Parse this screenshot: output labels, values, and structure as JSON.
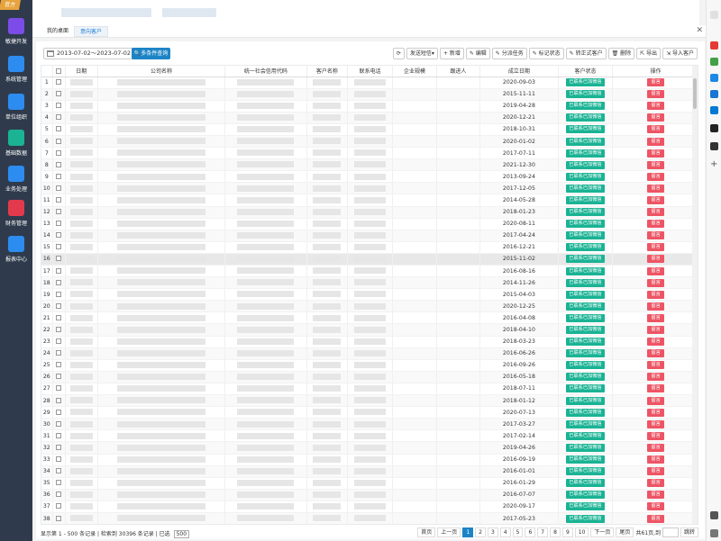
{
  "sidebar": {
    "badge": "官方",
    "items": [
      {
        "label": "敏捷开发",
        "icon": "paper-plane-icon",
        "color": "#7c4ce8"
      },
      {
        "label": "系统管理",
        "icon": "monitor-icon",
        "color": "#2d8cf0"
      },
      {
        "label": "单位组织",
        "icon": "coffee-cup-icon",
        "color": "#2d8cf0"
      },
      {
        "label": "基础数据",
        "icon": "database-icon",
        "color": "#1ab394"
      },
      {
        "label": "业务处理",
        "icon": "snowflake-icon",
        "color": "#2d8cf0"
      },
      {
        "label": "财务管理",
        "icon": "finance-icon",
        "color": "#e23a4c"
      },
      {
        "label": "报表中心",
        "icon": "chart-icon",
        "color": "#2d8cf0"
      }
    ]
  },
  "tabs": [
    {
      "label": "我的桌面"
    },
    {
      "label": "意向客户"
    }
  ],
  "search": {
    "date_range": "2013-07-02～2023-07-02",
    "button": "多条件查询"
  },
  "toolbar": [
    {
      "label": "⟳",
      "name": "refresh-button"
    },
    {
      "label": "发送短信▾",
      "name": "send-sms-button"
    },
    {
      "label": "+ 新增",
      "name": "add-button"
    },
    {
      "label": "✎ 编辑",
      "name": "edit-button"
    },
    {
      "label": "✎ 分派任务",
      "name": "assign-task-button"
    },
    {
      "label": "✎ 标记状态",
      "name": "mark-status-button"
    },
    {
      "label": "✎ 转正式客户",
      "name": "convert-customer-button"
    },
    {
      "label": "🗑 删除",
      "name": "delete-button"
    },
    {
      "label": "⇱ 导出",
      "name": "export-button"
    },
    {
      "label": "⇲ 导入客户",
      "name": "import-customer-button"
    }
  ],
  "table": {
    "headers": [
      "",
      "",
      "日期",
      "公司名称",
      "统一社会信用代码",
      "客户名称",
      "联系电话",
      "企业规模",
      "跟进人",
      "成立日期",
      "客户状态",
      "操作"
    ],
    "status_label": "已联系已加微信",
    "action_label": "留言",
    "rows": [
      {
        "n": "1",
        "d": "2020-09-03"
      },
      {
        "n": "2",
        "d": "2015-11-11"
      },
      {
        "n": "3",
        "d": "2019-04-28"
      },
      {
        "n": "4",
        "d": "2020-12-21"
      },
      {
        "n": "5",
        "d": "2018-10-31"
      },
      {
        "n": "6",
        "d": "2020-01-02"
      },
      {
        "n": "7",
        "d": "2017-07-11"
      },
      {
        "n": "8",
        "d": "2021-12-30"
      },
      {
        "n": "9",
        "d": "2013-09-24"
      },
      {
        "n": "10",
        "d": "2017-12-05"
      },
      {
        "n": "11",
        "d": "2014-05-28"
      },
      {
        "n": "12",
        "d": "2018-01-23"
      },
      {
        "n": "13",
        "d": "2020-08-11"
      },
      {
        "n": "14",
        "d": "2017-04-24"
      },
      {
        "n": "15",
        "d": "2016-12-21"
      },
      {
        "n": "16",
        "d": "2015-11-02"
      },
      {
        "n": "17",
        "d": "2016-08-16"
      },
      {
        "n": "18",
        "d": "2014-11-26"
      },
      {
        "n": "19",
        "d": "2015-04-03"
      },
      {
        "n": "20",
        "d": "2020-12-25"
      },
      {
        "n": "21",
        "d": "2016-04-08"
      },
      {
        "n": "22",
        "d": "2018-04-10"
      },
      {
        "n": "23",
        "d": "2018-03-23"
      },
      {
        "n": "24",
        "d": "2016-06-26"
      },
      {
        "n": "25",
        "d": "2016-09-26"
      },
      {
        "n": "26",
        "d": "2016-05-18"
      },
      {
        "n": "27",
        "d": "2018-07-11"
      },
      {
        "n": "28",
        "d": "2018-01-12"
      },
      {
        "n": "29",
        "d": "2020-07-13"
      },
      {
        "n": "30",
        "d": "2017-03-27"
      },
      {
        "n": "31",
        "d": "2017-02-14"
      },
      {
        "n": "32",
        "d": "2019-04-26"
      },
      {
        "n": "33",
        "d": "2016-09-19"
      },
      {
        "n": "34",
        "d": "2016-01-01"
      },
      {
        "n": "35",
        "d": "2016-01-29"
      },
      {
        "n": "36",
        "d": "2016-07-07"
      },
      {
        "n": "37",
        "d": "2020-09-17"
      },
      {
        "n": "38",
        "d": "2017-05-23"
      }
    ]
  },
  "footer": {
    "info_prefix": "显示第 1 - 500 条记录 | 检索到 30396 条记录 | 已选",
    "page_size": "500",
    "first": "首页",
    "prev": "上一页",
    "pages": [
      "1",
      "2",
      "3",
      "4",
      "5",
      "6",
      "7",
      "8",
      "9",
      "10"
    ],
    "next": "下一页",
    "last": "尾页",
    "total_pages": "共61页,到",
    "go": "跳转"
  }
}
